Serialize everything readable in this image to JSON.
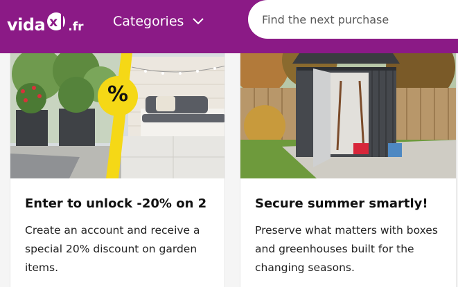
{
  "header": {
    "logo": {
      "word": "vida",
      "tld": ".fr"
    },
    "categories_label": "Categories",
    "search_placeholder": "Find the next purchase"
  },
  "cards": [
    {
      "badge": "%",
      "title": "Enter to unlock -20% on 2",
      "description": "Create an account and receive a special 20% discount on garden items."
    },
    {
      "title": "Secure summer smartly!",
      "description": "Preserve what matters with boxes and greenhouses built for the changing seasons."
    }
  ],
  "colors": {
    "brand": "#8b1a86",
    "badge": "#f5d816"
  },
  "icons": [
    "chevron-down-icon"
  ]
}
